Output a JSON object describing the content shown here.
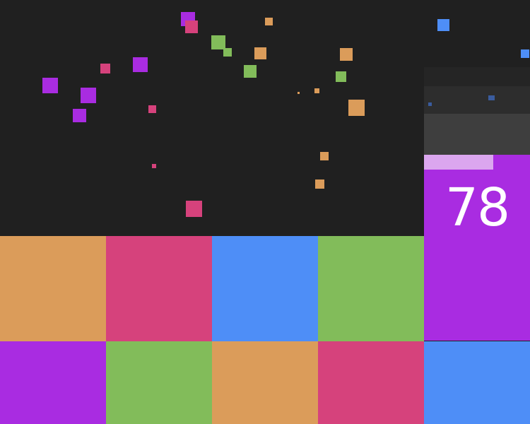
{
  "palette": {
    "background": "#202020",
    "orange": "#db9c5a",
    "pink": "#d6427c",
    "blue": "#4e8ef7",
    "green": "#82bc5a",
    "purple": "#a92ce1",
    "progress_light": "#dba6ef"
  },
  "score": {
    "value": "78",
    "progress": 0.65,
    "color": "purple"
  },
  "board": {
    "rows": [
      [
        "orange",
        "pink",
        "blue",
        "green"
      ],
      [
        "purple",
        "green",
        "orange",
        "pink",
        "blue"
      ]
    ]
  },
  "particles": {
    "count": 28
  }
}
